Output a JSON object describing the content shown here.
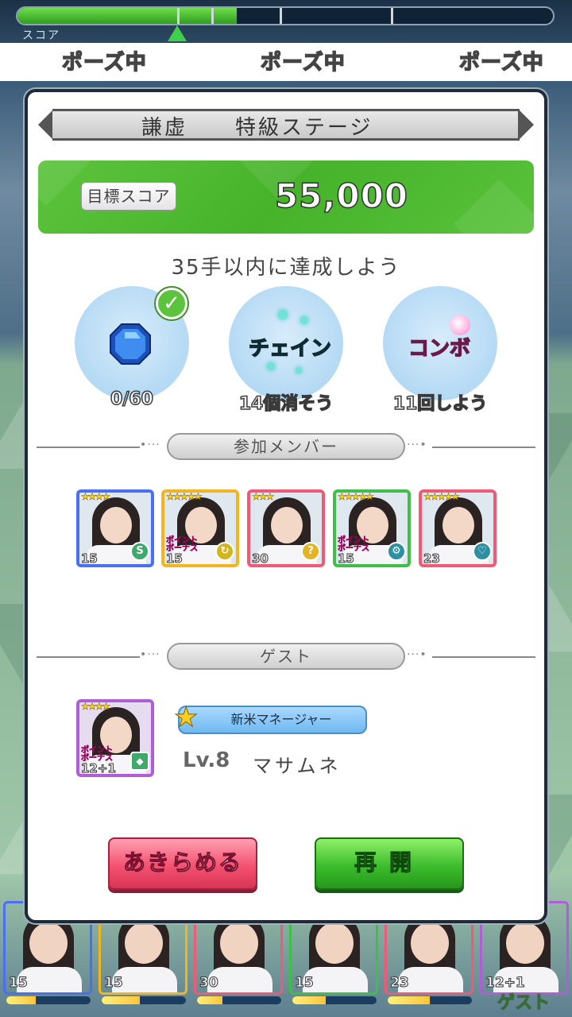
{
  "hud": {
    "score_label": "スコア",
    "score_progress": 0.41,
    "pause_labels": [
      "ポーズ中",
      "ポーズ中",
      "ポーズ中"
    ]
  },
  "stage": {
    "difficulty": "謙虚",
    "name": "特級ステージ"
  },
  "target": {
    "label": "目標スコア",
    "value": "55,000"
  },
  "mission": "35手以内に達成しよう",
  "goals": [
    {
      "icon": "gem-icon",
      "caption": "0/60",
      "completed": true
    },
    {
      "icon": "chain-icon",
      "word": "チェイン",
      "caption": "14個消そう",
      "completed": false
    },
    {
      "icon": "combo-icon",
      "word": "コンボ",
      "caption": "11回しよう",
      "completed": false
    }
  ],
  "members_header": "参加メンバー",
  "members": [
    {
      "stars": "★★★★",
      "level": "15",
      "frame_color": "#4a6ff0",
      "skill": "S",
      "skill_color": "#3fa86b",
      "point_bonus": false
    },
    {
      "stars": "★★★★★",
      "level": "15",
      "frame_color": "#f2b51d",
      "skill": "↻",
      "skill_color": "#d4b61c",
      "point_bonus": true
    },
    {
      "stars": "★★★",
      "level": "30",
      "frame_color": "#f05a76",
      "skill": "?",
      "skill_color": "#e3b42a",
      "point_bonus": false
    },
    {
      "stars": "★★★★★",
      "level": "15",
      "frame_color": "#3fbf4a",
      "skill": "⚙",
      "skill_color": "#2d8fa0",
      "point_bonus": true
    },
    {
      "stars": "★★★★★",
      "level": "23",
      "frame_color": "#f05a76",
      "skill": "♡",
      "skill_color": "#2d8fa0",
      "point_bonus": false
    }
  ],
  "point_bonus_label": "ポイント\nボーナス",
  "guest_header": "ゲスト",
  "guest": {
    "stars": "★★★★",
    "level": "12+1",
    "title": "新米マネージャー",
    "player_level": "Lv.8",
    "player_name": "マサムネ"
  },
  "buttons": {
    "quit": "あきらめる",
    "resume": "再開"
  },
  "bottom_strip": {
    "levels": [
      "15",
      "15",
      "30",
      "15",
      "23",
      "12+1"
    ],
    "guest_tag": "ゲスト"
  },
  "colors": {
    "accent_green": "#4cb92f",
    "quit_red": "#f3526f",
    "resume_green": "#3cbc2c"
  }
}
